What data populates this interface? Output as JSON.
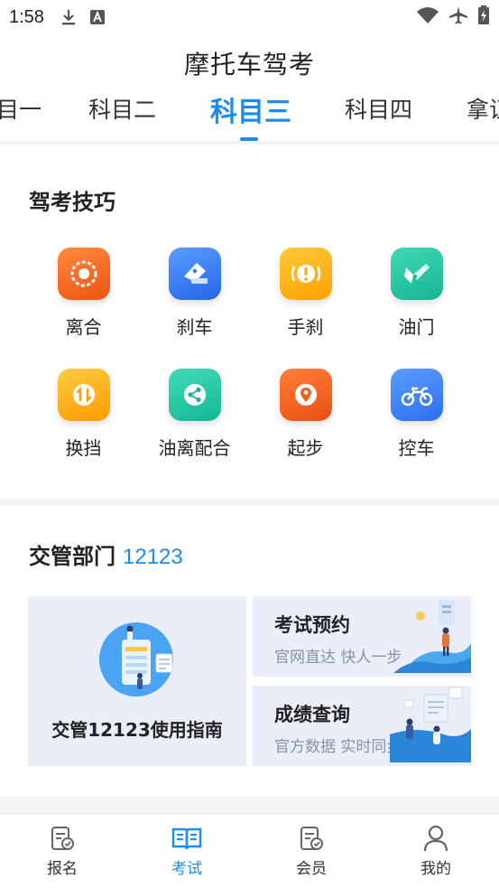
{
  "status_bar": {
    "time": "1:58",
    "icons": [
      "download-icon",
      "font-a-icon",
      "wifi-icon",
      "airplane-icon",
      "battery-charging-icon"
    ]
  },
  "header": {
    "title": "摩托车驾考",
    "tabs": [
      {
        "label": "科目一",
        "visible_text": "目一",
        "active": false
      },
      {
        "label": "科目二",
        "active": false
      },
      {
        "label": "科目三",
        "active": true
      },
      {
        "label": "科目四",
        "active": false
      },
      {
        "label": "拿证",
        "visible_text": "拿证",
        "active": false
      }
    ]
  },
  "tips": {
    "title": "驾考技巧",
    "items": [
      {
        "label": "离合",
        "icon": "clutch-icon",
        "color": "#f36a21"
      },
      {
        "label": "刹车",
        "icon": "brake-icon",
        "color": "#2f7cf6"
      },
      {
        "label": "手刹",
        "icon": "handbrake-icon",
        "color": "#ffb20e"
      },
      {
        "label": "油门",
        "icon": "throttle-icon",
        "color": "#27c4a3"
      },
      {
        "label": "换挡",
        "icon": "gear-shift-icon",
        "color": "#ffab12"
      },
      {
        "label": "油离配合",
        "icon": "coordination-icon",
        "color": "#25c7a5"
      },
      {
        "label": "起步",
        "icon": "start-location-icon",
        "color": "#f25f1e"
      },
      {
        "label": "控车",
        "icon": "motorcycle-icon",
        "color": "#3b82f6"
      }
    ]
  },
  "traffic": {
    "title": "交管部门",
    "number": "12123",
    "guide_label": "交管12123使用指南",
    "services": [
      {
        "title": "考试预约",
        "subtitle": "官网直达 快人一步"
      },
      {
        "title": "成绩查询",
        "subtitle": "官方数据 实时同步"
      }
    ]
  },
  "bottom_nav": [
    {
      "label": "报名",
      "icon": "register-icon",
      "active": false
    },
    {
      "label": "考试",
      "icon": "book-icon",
      "active": true
    },
    {
      "label": "会员",
      "icon": "member-icon",
      "active": false
    },
    {
      "label": "我的",
      "icon": "profile-icon",
      "active": false
    }
  ],
  "colors": {
    "accent": "#1a8cf0",
    "background": "#f3f3f3",
    "card": "#ffffff",
    "tile": "#e9eef8"
  }
}
